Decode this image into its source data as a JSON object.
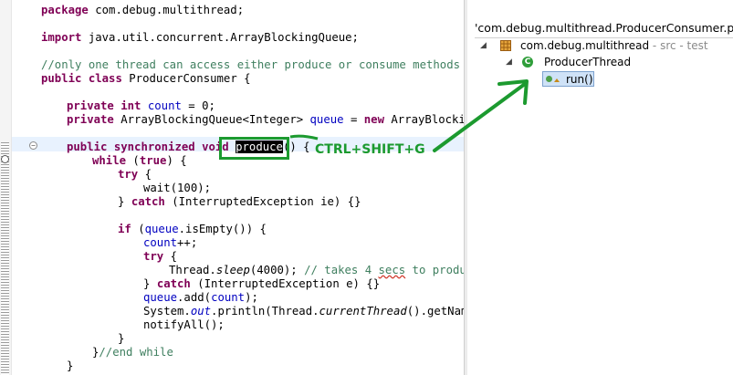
{
  "editor": {
    "lines": {
      "l1": {
        "a": "package",
        "b": " com.debug.multithread;"
      },
      "l2": {
        "a": "import",
        "b": " java.util.concurrent.ArrayBlockingQueue;"
      },
      "l3": {
        "c": "//only one thread can access either produce or consume methods as"
      },
      "l4": {
        "a": "public",
        "b": " ",
        "c": "class",
        "d": " ProducerConsumer {"
      },
      "l5": {
        "a": "private",
        "b": " ",
        "c": "int",
        "d": " ",
        "e": "count",
        "f": " = 0;"
      },
      "l6": {
        "a": "private",
        "b": " ArrayBlockingQueue<Integer> ",
        "c": "queue",
        "d": " = ",
        "e": "new",
        "f": " ArrayBlocking("
      },
      "l7": {
        "a": "public",
        "b": " ",
        "c": "synchronized",
        "d": " ",
        "e": "void",
        "f": " ",
        "g": "produce",
        "h": "() {"
      },
      "l8": {
        "a": "while",
        "b": " (",
        "c": "true",
        "d": ") {"
      },
      "l9": {
        "a": "try",
        "b": " {"
      },
      "l10": {
        "a": "wait(100);"
      },
      "l11": {
        "a": "} ",
        "b": "catch",
        "c": " (InterruptedException ie) {}"
      },
      "l12": {
        "a": "if",
        "b": " (",
        "c": "queue",
        "d": ".isEmpty()) {"
      },
      "l13": {
        "a": "count",
        "b": "++;"
      },
      "l14": {
        "a": "try",
        "b": " {"
      },
      "l15": {
        "a": "Thread.",
        "b": "sleep",
        "c": "(4000); ",
        "d": "// takes 4 ",
        "e": "secs",
        "f": " to produce"
      },
      "l16": {
        "a": "} ",
        "b": "catch",
        "c": " (InterruptedException e) {}"
      },
      "l17": {
        "a": "queue",
        "b": ".add(",
        "c": "count",
        "d": ");"
      },
      "l18": {
        "a": "System.",
        "b": "out",
        "c": ".println(Thread.",
        "d": "currentThread",
        "e": "().getName("
      },
      "l19": {
        "a": "notifyAll();"
      },
      "l20": {
        "a": "}"
      },
      "l21": {
        "a": "}",
        "b": "//end while"
      },
      "l22": {
        "a": "}"
      }
    }
  },
  "hierarchy": {
    "title": "'com.debug.multithread.ProducerConsumer.produce",
    "package_label": "com.debug.multithread",
    "package_suffix": " - src - test",
    "class_label": "ProducerThread",
    "class_icon_letter": "C",
    "method_label": "run()"
  },
  "annotation": {
    "shortcut": "CTRL+SHIFT+G",
    "color": "#1c9a2f"
  },
  "colors": {
    "keyword": "#7f0055",
    "comment": "#3f7f5f",
    "field": "#0000c0",
    "selection": "#000000"
  }
}
